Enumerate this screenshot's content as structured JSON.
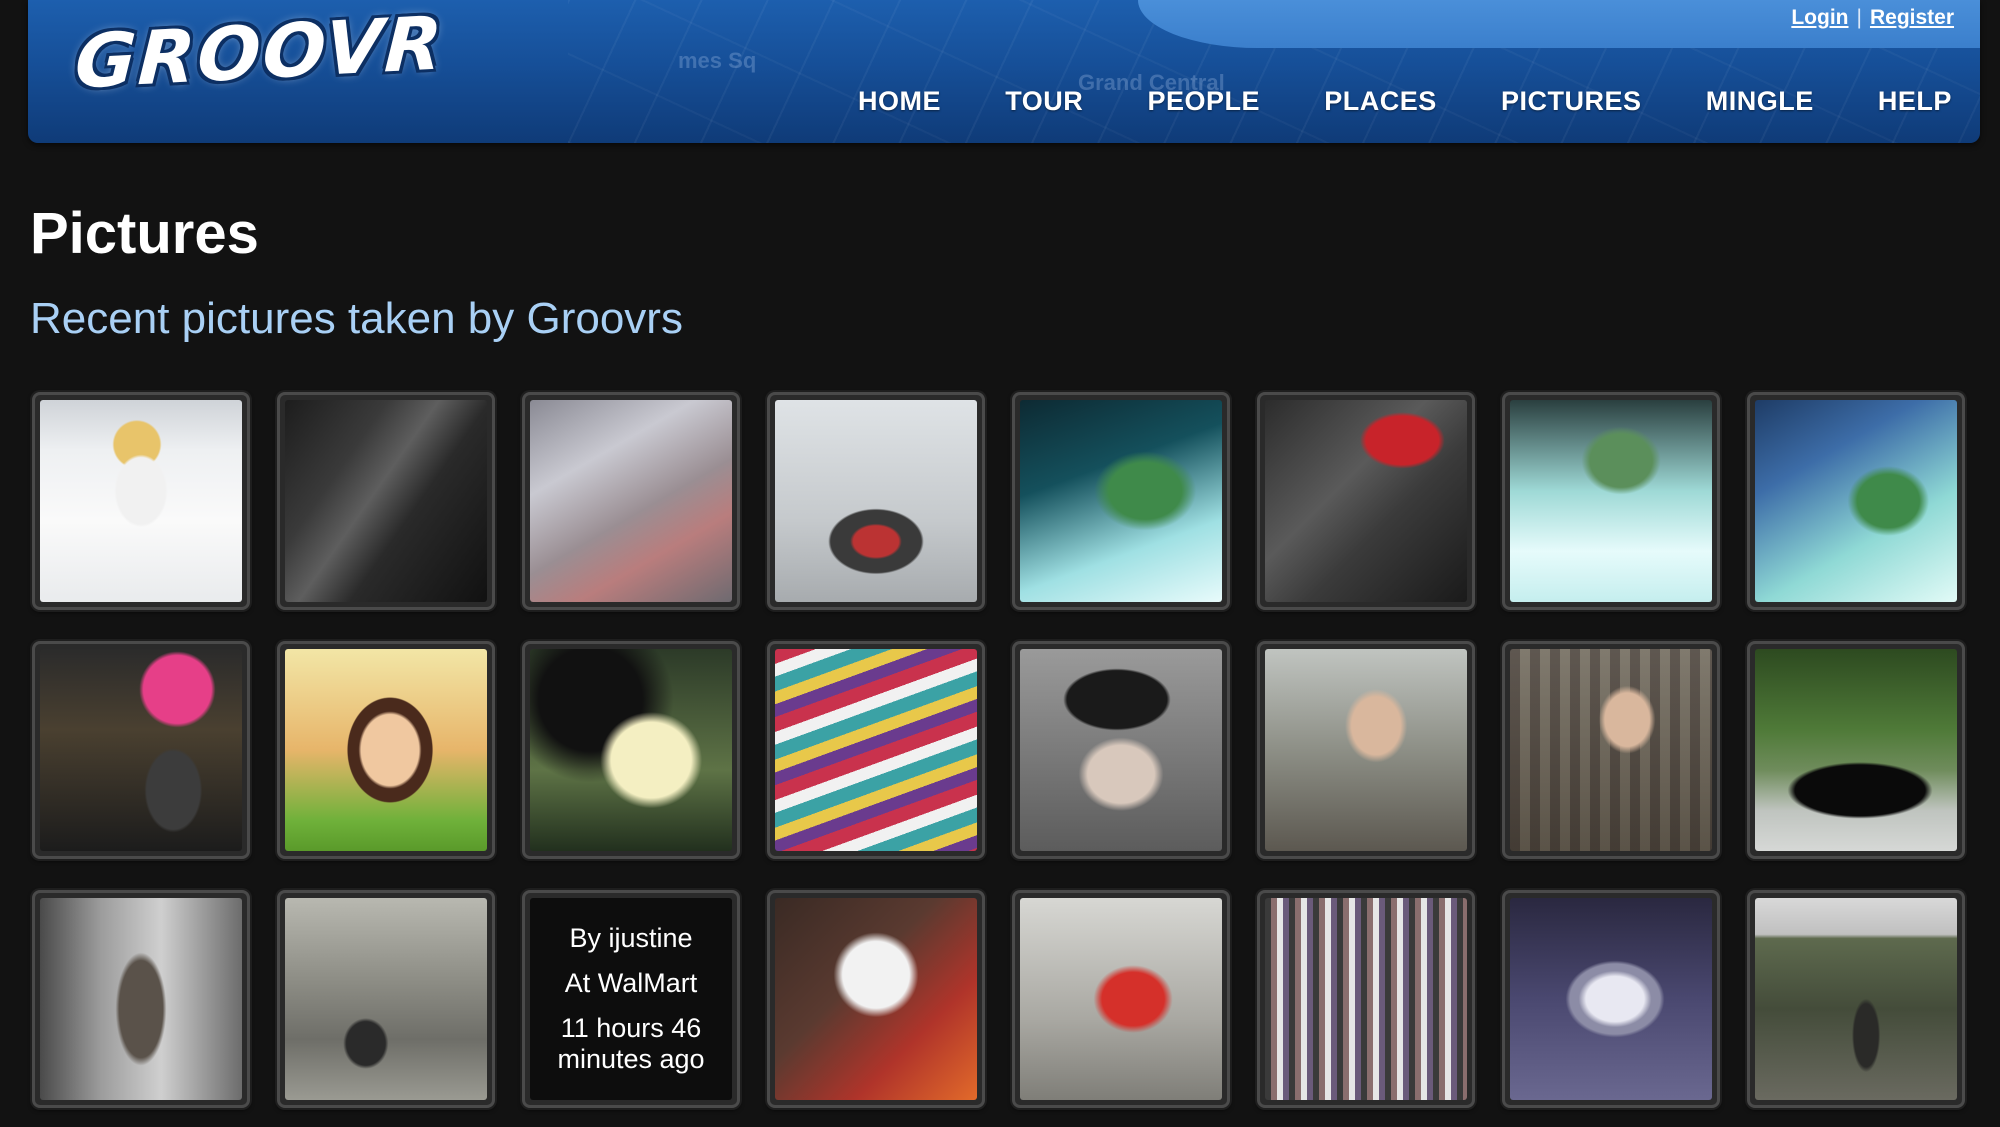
{
  "header": {
    "logo": "GROOVR",
    "login": "Login",
    "separator": "|",
    "register": "Register",
    "nav": [
      "HOME",
      "TOUR",
      "PEOPLE",
      "PLACES",
      "PICTURES",
      "MINGLE",
      "HELP"
    ]
  },
  "page": {
    "title": "Pictures",
    "subtitle": "Recent pictures taken by Groovrs"
  },
  "info_card": {
    "by": "By ijustine",
    "at": "At WalMart",
    "time_line1": "11 hours 46",
    "time_line2": "minutes ago"
  },
  "photos": [
    "avatar-snow",
    "dark-doorway",
    "tokyo-sign",
    "virtual-plane",
    "cat-laptop-1",
    "macbook-bag",
    "cat-pillow",
    "cat-laptop-2",
    "pink-hair-avatar",
    "woman-portrait",
    "man-closeup",
    "cat-striped-blanket",
    "man-in-cap",
    "man-with-phone",
    "man-plaid-shirt",
    "black-car",
    "blurred-figure",
    "kitchen-worker",
    "info-card",
    "white-puppy",
    "person-red-jacket",
    "clothing-store",
    "gem-ring",
    "field-person"
  ]
}
